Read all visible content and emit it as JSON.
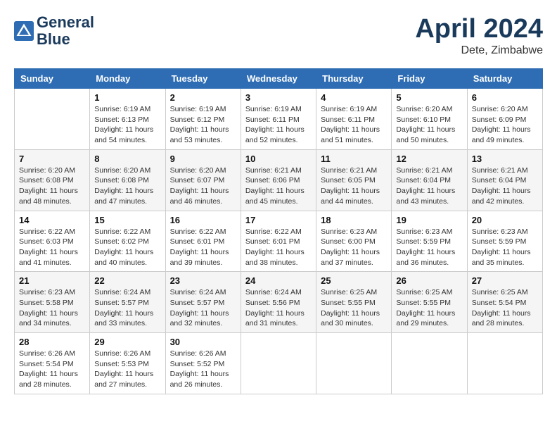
{
  "header": {
    "logo_line1": "General",
    "logo_line2": "Blue",
    "month": "April 2024",
    "location": "Dete, Zimbabwe"
  },
  "days_of_week": [
    "Sunday",
    "Monday",
    "Tuesday",
    "Wednesday",
    "Thursday",
    "Friday",
    "Saturday"
  ],
  "weeks": [
    [
      {
        "day": "",
        "info": ""
      },
      {
        "day": "1",
        "info": "Sunrise: 6:19 AM\nSunset: 6:13 PM\nDaylight: 11 hours\nand 54 minutes."
      },
      {
        "day": "2",
        "info": "Sunrise: 6:19 AM\nSunset: 6:12 PM\nDaylight: 11 hours\nand 53 minutes."
      },
      {
        "day": "3",
        "info": "Sunrise: 6:19 AM\nSunset: 6:11 PM\nDaylight: 11 hours\nand 52 minutes."
      },
      {
        "day": "4",
        "info": "Sunrise: 6:19 AM\nSunset: 6:11 PM\nDaylight: 11 hours\nand 51 minutes."
      },
      {
        "day": "5",
        "info": "Sunrise: 6:20 AM\nSunset: 6:10 PM\nDaylight: 11 hours\nand 50 minutes."
      },
      {
        "day": "6",
        "info": "Sunrise: 6:20 AM\nSunset: 6:09 PM\nDaylight: 11 hours\nand 49 minutes."
      }
    ],
    [
      {
        "day": "7",
        "info": "Sunrise: 6:20 AM\nSunset: 6:08 PM\nDaylight: 11 hours\nand 48 minutes."
      },
      {
        "day": "8",
        "info": "Sunrise: 6:20 AM\nSunset: 6:08 PM\nDaylight: 11 hours\nand 47 minutes."
      },
      {
        "day": "9",
        "info": "Sunrise: 6:20 AM\nSunset: 6:07 PM\nDaylight: 11 hours\nand 46 minutes."
      },
      {
        "day": "10",
        "info": "Sunrise: 6:21 AM\nSunset: 6:06 PM\nDaylight: 11 hours\nand 45 minutes."
      },
      {
        "day": "11",
        "info": "Sunrise: 6:21 AM\nSunset: 6:05 PM\nDaylight: 11 hours\nand 44 minutes."
      },
      {
        "day": "12",
        "info": "Sunrise: 6:21 AM\nSunset: 6:04 PM\nDaylight: 11 hours\nand 43 minutes."
      },
      {
        "day": "13",
        "info": "Sunrise: 6:21 AM\nSunset: 6:04 PM\nDaylight: 11 hours\nand 42 minutes."
      }
    ],
    [
      {
        "day": "14",
        "info": "Sunrise: 6:22 AM\nSunset: 6:03 PM\nDaylight: 11 hours\nand 41 minutes."
      },
      {
        "day": "15",
        "info": "Sunrise: 6:22 AM\nSunset: 6:02 PM\nDaylight: 11 hours\nand 40 minutes."
      },
      {
        "day": "16",
        "info": "Sunrise: 6:22 AM\nSunset: 6:01 PM\nDaylight: 11 hours\nand 39 minutes."
      },
      {
        "day": "17",
        "info": "Sunrise: 6:22 AM\nSunset: 6:01 PM\nDaylight: 11 hours\nand 38 minutes."
      },
      {
        "day": "18",
        "info": "Sunrise: 6:23 AM\nSunset: 6:00 PM\nDaylight: 11 hours\nand 37 minutes."
      },
      {
        "day": "19",
        "info": "Sunrise: 6:23 AM\nSunset: 5:59 PM\nDaylight: 11 hours\nand 36 minutes."
      },
      {
        "day": "20",
        "info": "Sunrise: 6:23 AM\nSunset: 5:59 PM\nDaylight: 11 hours\nand 35 minutes."
      }
    ],
    [
      {
        "day": "21",
        "info": "Sunrise: 6:23 AM\nSunset: 5:58 PM\nDaylight: 11 hours\nand 34 minutes."
      },
      {
        "day": "22",
        "info": "Sunrise: 6:24 AM\nSunset: 5:57 PM\nDaylight: 11 hours\nand 33 minutes."
      },
      {
        "day": "23",
        "info": "Sunrise: 6:24 AM\nSunset: 5:57 PM\nDaylight: 11 hours\nand 32 minutes."
      },
      {
        "day": "24",
        "info": "Sunrise: 6:24 AM\nSunset: 5:56 PM\nDaylight: 11 hours\nand 31 minutes."
      },
      {
        "day": "25",
        "info": "Sunrise: 6:25 AM\nSunset: 5:55 PM\nDaylight: 11 hours\nand 30 minutes."
      },
      {
        "day": "26",
        "info": "Sunrise: 6:25 AM\nSunset: 5:55 PM\nDaylight: 11 hours\nand 29 minutes."
      },
      {
        "day": "27",
        "info": "Sunrise: 6:25 AM\nSunset: 5:54 PM\nDaylight: 11 hours\nand 28 minutes."
      }
    ],
    [
      {
        "day": "28",
        "info": "Sunrise: 6:26 AM\nSunset: 5:54 PM\nDaylight: 11 hours\nand 28 minutes."
      },
      {
        "day": "29",
        "info": "Sunrise: 6:26 AM\nSunset: 5:53 PM\nDaylight: 11 hours\nand 27 minutes."
      },
      {
        "day": "30",
        "info": "Sunrise: 6:26 AM\nSunset: 5:52 PM\nDaylight: 11 hours\nand 26 minutes."
      },
      {
        "day": "",
        "info": ""
      },
      {
        "day": "",
        "info": ""
      },
      {
        "day": "",
        "info": ""
      },
      {
        "day": "",
        "info": ""
      }
    ]
  ]
}
